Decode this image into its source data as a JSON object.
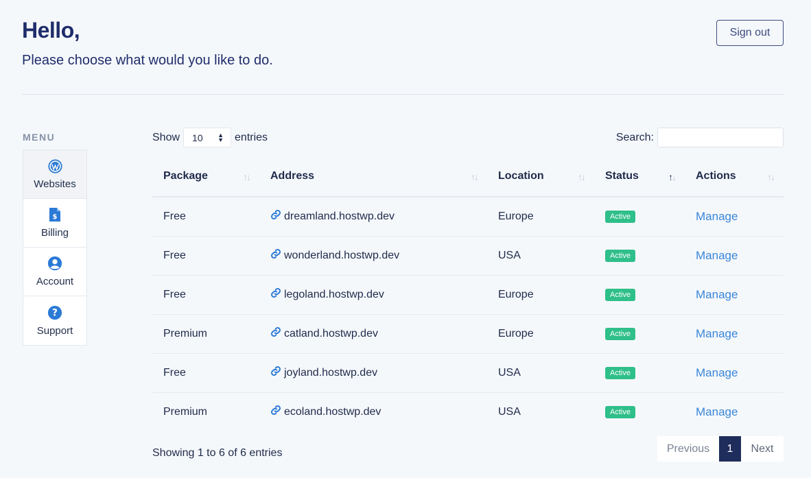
{
  "header": {
    "greeting": "Hello,",
    "subtitle": "Please choose what would you like to do.",
    "signout_label": "Sign out"
  },
  "menu": {
    "title": "MENU",
    "items": [
      {
        "label": "Websites",
        "icon": "wordpress-icon",
        "active": true
      },
      {
        "label": "Billing",
        "icon": "invoice-icon"
      },
      {
        "label": "Account",
        "icon": "user-circle-icon"
      },
      {
        "label": "Support",
        "icon": "question-circle-icon"
      }
    ]
  },
  "controls": {
    "show_label": "Show",
    "entries_value": "10",
    "entries_label": "entries",
    "search_label": "Search:",
    "search_value": ""
  },
  "table": {
    "columns": [
      "Package",
      "Address",
      "Location",
      "Status",
      "Actions"
    ],
    "rows": [
      {
        "package": "Free",
        "address": "dreamland.hostwp.dev",
        "location": "Europe",
        "status": "Active",
        "action": "Manage"
      },
      {
        "package": "Free",
        "address": "wonderland.hostwp.dev",
        "location": "USA",
        "status": "Active",
        "action": "Manage"
      },
      {
        "package": "Free",
        "address": "legoland.hostwp.dev",
        "location": "Europe",
        "status": "Active",
        "action": "Manage"
      },
      {
        "package": "Premium",
        "address": "catland.hostwp.dev",
        "location": "Europe",
        "status": "Active",
        "action": "Manage"
      },
      {
        "package": "Free",
        "address": "joyland.hostwp.dev",
        "location": "USA",
        "status": "Active",
        "action": "Manage"
      },
      {
        "package": "Premium",
        "address": "ecoland.hostwp.dev",
        "location": "USA",
        "status": "Active",
        "action": "Manage"
      }
    ]
  },
  "footer": {
    "info": "Showing 1 to 6 of 6 entries",
    "previous": "Previous",
    "current_page": "1",
    "next": "Next"
  },
  "colors": {
    "accent": "#1f2d6b",
    "link": "#3a86d8",
    "active_badge": "#2fbf8a"
  }
}
